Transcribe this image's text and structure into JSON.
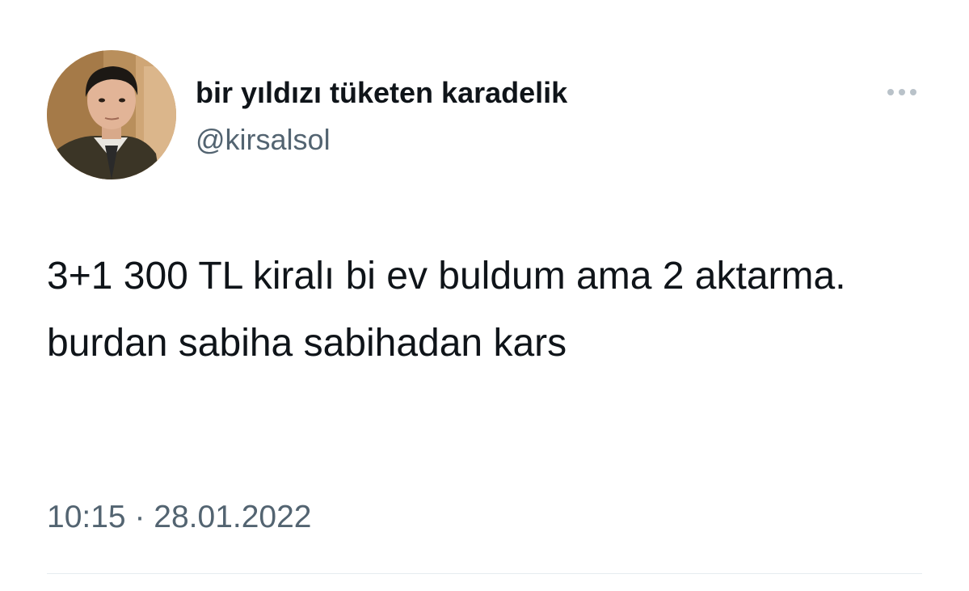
{
  "tweet": {
    "author": {
      "display_name": "bir yıldızı tüketen karadelik",
      "handle": "@kirsalsol",
      "avatar_icon": "profile-photo"
    },
    "more_icon": "ellipsis-icon",
    "text": "3+1 300 TL kiralı bi ev buldum ama 2 aktarma. burdan sabiha sabihadan kars",
    "time": "10:15",
    "separator": "·",
    "date": "28.01.2022"
  },
  "colors": {
    "text_primary": "#0f1419",
    "text_secondary": "#536471",
    "divider": "#e6ecf0"
  }
}
